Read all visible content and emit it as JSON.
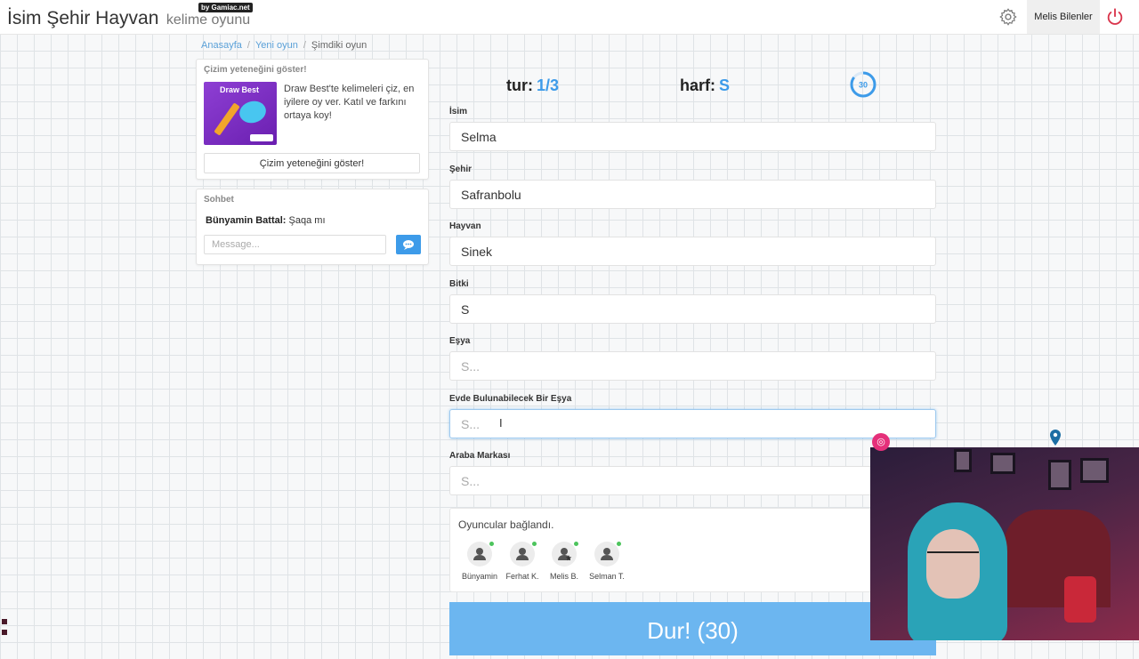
{
  "header": {
    "title": "İsim Şehir Hayvan",
    "subtitle": "kelime oyunu",
    "byline": "by Gamiac.net",
    "user_name": "Melis Bilenler"
  },
  "breadcrumb": {
    "home": "Anasayfa",
    "new_game": "Yeni oyun",
    "current": "Şimdiki oyun"
  },
  "draw_panel": {
    "title": "Çizim yeteneğini göster!",
    "thumb_title": "Draw Best",
    "description": "Draw Best'te kelimeleri çiz, en iyilere oy ver. Katıl ve farkını ortaya koy!",
    "button_label": "Çizim yeteneğini göster!"
  },
  "chat": {
    "title": "Sohbet",
    "messages": [
      {
        "author": "Bünyamin Battal:",
        "text": "Şaqa mı"
      }
    ],
    "input_placeholder": "Message..."
  },
  "game": {
    "round_label": "tur:",
    "round_value": "1/3",
    "letter_label": "harf:",
    "letter_value": "S",
    "timer": "30",
    "timer_progress": 0.85
  },
  "fields": [
    {
      "label": "İsim",
      "value": "Selma",
      "placeholder": "S..."
    },
    {
      "label": "Şehir",
      "value": "Safranbolu",
      "placeholder": "S..."
    },
    {
      "label": "Hayvan",
      "value": "Sinek",
      "placeholder": "S..."
    },
    {
      "label": "Bitki",
      "value": "S",
      "placeholder": "S..."
    },
    {
      "label": "Eşya",
      "value": "",
      "placeholder": "S..."
    },
    {
      "label": "Evde Bulunabilecek Bir Eşya",
      "value": "",
      "placeholder": "S..."
    },
    {
      "label": "Araba Markası",
      "value": "",
      "placeholder": "S..."
    }
  ],
  "players": {
    "title": "Oyuncular bağlandı.",
    "list": [
      {
        "name": "Bünyamin"
      },
      {
        "name": "Ferhat K."
      },
      {
        "name": "Melis B."
      },
      {
        "name": "Selman T."
      }
    ]
  },
  "stop_button": "Dur! (30)",
  "colors": {
    "accent": "#3d9be9",
    "stop_button": "#6cb6f0",
    "online": "#4cc45c",
    "power": "#d9344b"
  },
  "icons": [
    "settings-gear-icon",
    "power-icon",
    "send-message-icon",
    "user-avatar-icon",
    "instagram-icon",
    "location-pin-icon"
  ]
}
